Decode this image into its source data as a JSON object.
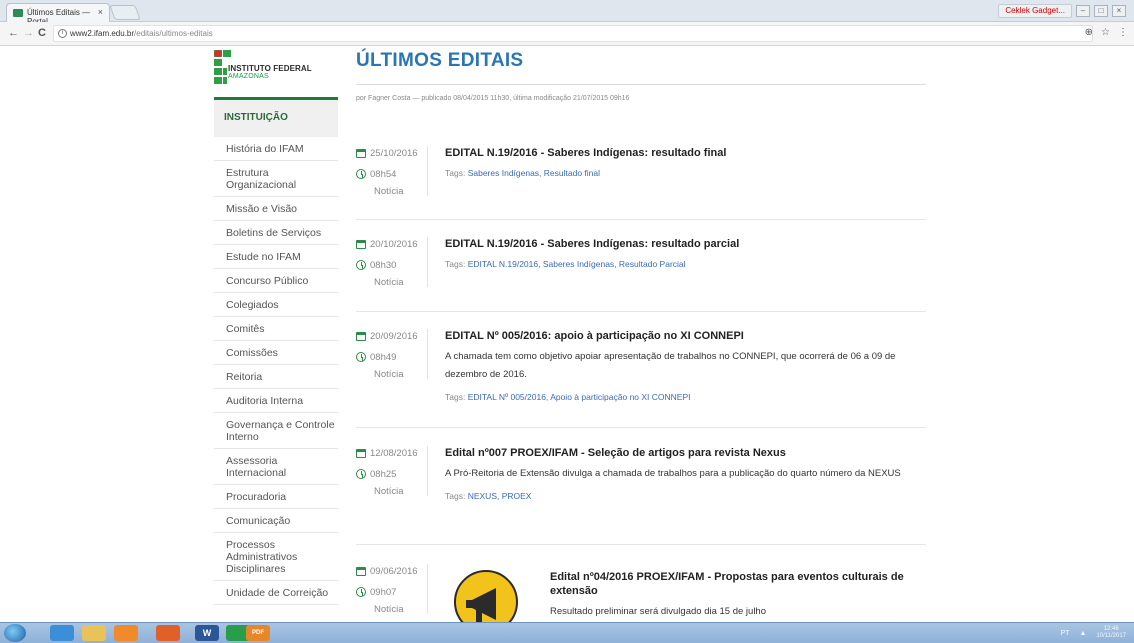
{
  "browser": {
    "tab_title": "Últimos Editais — Portal",
    "tab_close": "×",
    "profile_label": "Ceklek Gadget...",
    "url_host": "www2.ifam.edu.br",
    "url_path": "/editais/ultimos-editais",
    "back_glyph": "←",
    "forward_glyph": "→",
    "reload_glyph": "C",
    "zoom_glyph": "⊕",
    "star_glyph": "☆",
    "menu_glyph": "⋮",
    "info_glyph": "i",
    "min_glyph": "–",
    "max_glyph": "□",
    "close_glyph": "×"
  },
  "logo": {
    "line1": "INSTITUTO FEDERAL",
    "line2": "AMAZONAS",
    "colors": {
      "green": "#2f9e44",
      "red": "#d32f2f"
    }
  },
  "sidebar": {
    "header": "INSTITUIÇÃO",
    "items": [
      "História do IFAM",
      "Estrutura Organizacional",
      "Missão e Visão",
      "Boletins de Serviços",
      "Estude no IFAM",
      "Concurso Público",
      "Colegiados",
      "Comitês",
      "Comissões",
      "Reitoria",
      "Auditoria Interna",
      "Governança e Controle Interno",
      "Assessoria Internacional",
      "Procuradoria",
      "Comunicação",
      "Processos Administrativos Disciplinares",
      "Unidade de Correição"
    ]
  },
  "main": {
    "title": "ÚLTIMOS EDITAIS",
    "byline": "por Fagner Costa — publicado 08/04/2015 11h30, última modificação 21/07/2015 09h16",
    "tags_label": "Tags:",
    "items": [
      {
        "date": "25/10/2016",
        "time": "08h54",
        "kind": "Notícia",
        "title": "EDITAL N.19/2016 - Saberes Indígenas: resultado final",
        "desc": "",
        "tags": "Saberes Indígenas, Resultado final"
      },
      {
        "date": "20/10/2016",
        "time": "08h30",
        "kind": "Notícia",
        "title": "EDITAL N.19/2016 - Saberes Indígenas: resultado parcial",
        "desc": "",
        "tags": "EDITAL N.19/2016, Saberes Indígenas, Resultado Parcial"
      },
      {
        "date": "20/09/2016",
        "time": "08h49",
        "kind": "Notícia",
        "title": "EDITAL Nº 005/2016: apoio à participação no XI CONNEPI",
        "desc": "A chamada tem como objetivo apoiar apresentação de trabalhos no CONNEPI, que ocorrerá de 06 a 09 de dezembro de 2016.",
        "tags": "EDITAL Nº 005/2016, Apoio à participação no XI CONNEPI"
      },
      {
        "date": "12/08/2016",
        "time": "08h25",
        "kind": "Notícia",
        "title": "Edital nº007 PROEX/IFAM - Seleção de artigos para revista Nexus",
        "desc": "A Pró-Reitoria de Extensão divulga a chamada de trabalhos para a publicação do quarto número da NEXUS",
        "tags": "NEXUS, PROEX"
      },
      {
        "date": "09/06/2016",
        "time": "09h07",
        "kind": "Notícia",
        "title": "Edital nº04/2016 PROEX/IFAM - Propostas para eventos culturais de extensão",
        "desc": "Resultado preliminar será divulgado dia 15 de julho",
        "tags": ""
      }
    ]
  },
  "taskbar": {
    "lang": "PT",
    "time": "12:46",
    "date": "10/11/2017",
    "word_label": "W",
    "pdf_label": "PDF"
  }
}
